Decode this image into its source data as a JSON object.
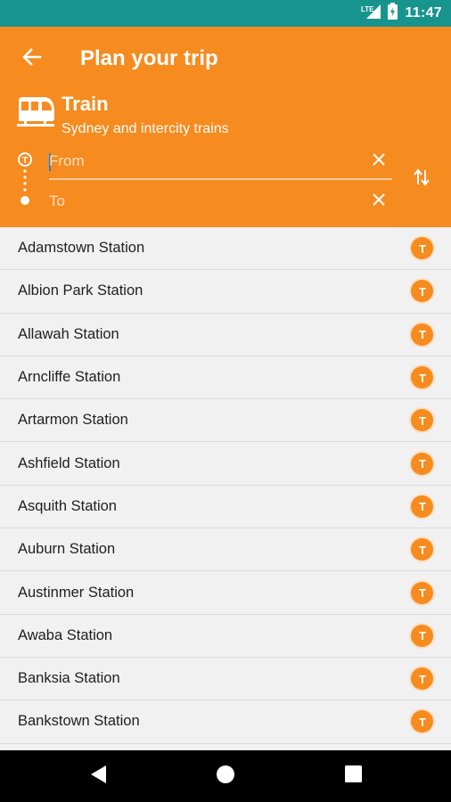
{
  "status_bar": {
    "time": "11:47",
    "network_label": "LTE",
    "icons": [
      "lte-signal-icon",
      "battery-icon"
    ]
  },
  "header": {
    "title": "Plan your trip",
    "back_icon": "arrow-left-icon",
    "mode": {
      "title": "Train",
      "subtitle": "Sydney and intercity trains",
      "icon": "train-icon"
    },
    "from_field": {
      "value": "",
      "placeholder": "From"
    },
    "to_field": {
      "value": "",
      "placeholder": "To"
    },
    "swap_icon": "swap-vertical-icon",
    "clear_icon": "close-icon",
    "colors": {
      "brand": "#f68b1f",
      "status_bar": "#18948e"
    }
  },
  "stations": [
    {
      "name": "Adamstown Station",
      "badge": "T"
    },
    {
      "name": "Albion Park Station",
      "badge": "T"
    },
    {
      "name": "Allawah Station",
      "badge": "T"
    },
    {
      "name": "Arncliffe Station",
      "badge": "T"
    },
    {
      "name": "Artarmon Station",
      "badge": "T"
    },
    {
      "name": "Ashfield Station",
      "badge": "T"
    },
    {
      "name": "Asquith Station",
      "badge": "T"
    },
    {
      "name": "Auburn Station",
      "badge": "T"
    },
    {
      "name": "Austinmer Station",
      "badge": "T"
    },
    {
      "name": "Awaba Station",
      "badge": "T"
    },
    {
      "name": "Banksia Station",
      "badge": "T"
    },
    {
      "name": "Bankstown Station",
      "badge": "T"
    }
  ],
  "nav_bar": {
    "icons": [
      "back-triangle-icon",
      "home-circle-icon",
      "recents-square-icon"
    ]
  }
}
